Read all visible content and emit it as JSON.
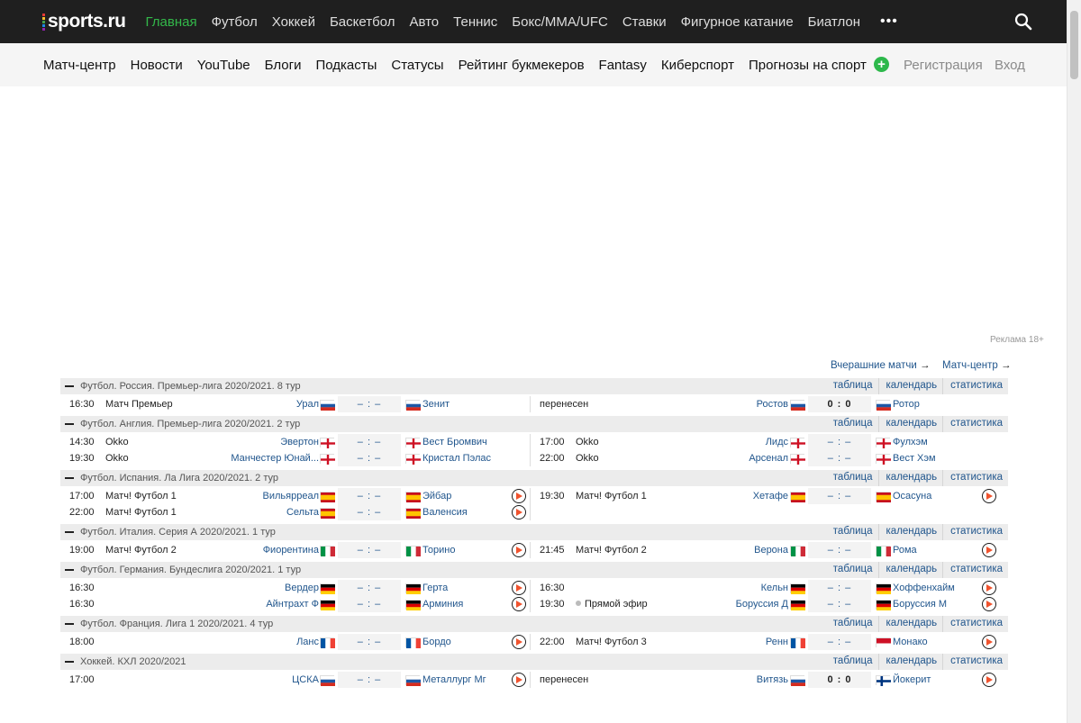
{
  "brand": {
    "logo": "sports.ru"
  },
  "topnav": [
    "Главная",
    "Футбол",
    "Хоккей",
    "Баскетбол",
    "Авто",
    "Теннис",
    "Бокс/MMA/UFC",
    "Ставки",
    "Фигурное катание",
    "Биатлон"
  ],
  "more": "•••",
  "subnav": [
    "Матч-центр",
    "Новости",
    "YouTube",
    "Блоги",
    "Подкасты",
    "Статусы",
    "Рейтинг букмекеров",
    "Fantasy",
    "Киберспорт",
    "Прогнозы на спорт"
  ],
  "auth": {
    "register": "Регистрация",
    "login": "Вход"
  },
  "ad_label": "Реклама 18+",
  "links": {
    "yesterday": "Вчерашние матчи",
    "match_center": "Матч-центр"
  },
  "league_links": {
    "table": "таблица",
    "calendar": "календарь",
    "stats": "статистика"
  },
  "leagues": [
    {
      "title": "Футбол. Россия. Премьер-лига 2020/2021. 8 тур",
      "rows": [
        [
          {
            "time": "16:30",
            "tv": "Матч Премьер",
            "home": "Урал",
            "home_flag": "ru",
            "score": "– : –",
            "away": "Зенит",
            "away_flag": "ru",
            "play": false
          },
          {
            "time": "перенесен",
            "tv": "",
            "home": "Ростов",
            "home_flag": "ru",
            "score": "0 : 0",
            "final": true,
            "away": "Ротор",
            "away_flag": "ru",
            "play": false
          }
        ]
      ]
    },
    {
      "title": "Футбол. Англия. Премьер-лига 2020/2021. 2 тур",
      "rows": [
        [
          {
            "time": "14:30",
            "tv": "Okko",
            "home": "Эвертон",
            "home_flag": "en",
            "score": "– : –",
            "away": "Вест Бромвич",
            "away_flag": "en",
            "play": false
          },
          {
            "time": "17:00",
            "tv": "Okko",
            "home": "Лидс",
            "home_flag": "en",
            "score": "– : –",
            "away": "Фулхэм",
            "away_flag": "en",
            "play": false
          }
        ],
        [
          {
            "time": "19:30",
            "tv": "Okko",
            "home": "Манчестер Юнай...",
            "home_flag": "en",
            "score": "– : –",
            "away": "Кристал Пэлас",
            "away_flag": "en",
            "play": false
          },
          {
            "time": "22:00",
            "tv": "Okko",
            "home": "Арсенал",
            "home_flag": "en",
            "score": "– : –",
            "away": "Вест Хэм",
            "away_flag": "en",
            "play": false
          }
        ]
      ]
    },
    {
      "title": "Футбол. Испания. Ла Лига 2020/2021. 2 тур",
      "rows": [
        [
          {
            "time": "17:00",
            "tv": "Матч! Футбол 1",
            "home": "Вильярреал",
            "home_flag": "es",
            "score": "– : –",
            "away": "Эйбар",
            "away_flag": "es",
            "play": true
          },
          {
            "time": "19:30",
            "tv": "Матч! Футбол 1",
            "home": "Хетафе",
            "home_flag": "es",
            "score": "– : –",
            "away": "Осасуна",
            "away_flag": "es",
            "play": true
          }
        ],
        [
          {
            "time": "22:00",
            "tv": "Матч! Футбол 1",
            "home": "Сельта",
            "home_flag": "es",
            "score": "– : –",
            "away": "Валенсия",
            "away_flag": "es",
            "play": true
          },
          null
        ]
      ]
    },
    {
      "title": "Футбол. Италия. Серия А 2020/2021. 1 тур",
      "rows": [
        [
          {
            "time": "19:00",
            "tv": "Матч! Футбол 2",
            "home": "Фиорентина",
            "home_flag": "it",
            "score": "– : –",
            "away": "Торино",
            "away_flag": "it",
            "play": true
          },
          {
            "time": "21:45",
            "tv": "Матч! Футбол 2",
            "home": "Верона",
            "home_flag": "it",
            "score": "– : –",
            "away": "Рома",
            "away_flag": "it",
            "play": true
          }
        ]
      ]
    },
    {
      "title": "Футбол. Германия. Бундеслига 2020/2021. 1 тур",
      "rows": [
        [
          {
            "time": "16:30",
            "tv": "",
            "home": "Вердер",
            "home_flag": "de",
            "score": "– : –",
            "away": "Герта",
            "away_flag": "de",
            "play": true
          },
          {
            "time": "16:30",
            "tv": "",
            "home": "Кельн",
            "home_flag": "de",
            "score": "– : –",
            "away": "Хоффенхайм",
            "away_flag": "de",
            "play": true
          }
        ],
        [
          {
            "time": "16:30",
            "tv": "",
            "home": "Айнтрахт Ф",
            "home_flag": "de",
            "score": "– : –",
            "away": "Арминия",
            "away_flag": "de",
            "play": true
          },
          {
            "time": "19:30",
            "tv": "Прямой эфир",
            "live": true,
            "home": "Боруссия Д",
            "home_flag": "de",
            "score": "– : –",
            "away": "Боруссия М",
            "away_flag": "de",
            "play": true
          }
        ]
      ]
    },
    {
      "title": "Футбол. Франция. Лига 1 2020/2021. 4 тур",
      "rows": [
        [
          {
            "time": "18:00",
            "tv": "",
            "home": "Ланс",
            "home_flag": "fr",
            "score": "– : –",
            "away": "Бордо",
            "away_flag": "fr",
            "play": true
          },
          {
            "time": "22:00",
            "tv": "Матч! Футбол 3",
            "home": "Ренн",
            "home_flag": "fr",
            "score": "– : –",
            "away": "Монако",
            "away_flag": "mc",
            "play": true
          }
        ]
      ]
    },
    {
      "title": "Хоккей. КХЛ 2020/2021",
      "rows": [
        [
          {
            "time": "17:00",
            "tv": "",
            "home": "ЦСКА",
            "home_flag": "ru",
            "score": "– : –",
            "away": "Металлург Мг",
            "away_flag": "ru",
            "play": true
          },
          {
            "time": "перенесен",
            "tv": "",
            "home": "Витязь",
            "home_flag": "ru",
            "score": "0 : 0",
            "final": true,
            "away": "Йокерит",
            "away_flag": "fi",
            "play": true
          }
        ]
      ]
    }
  ],
  "colors": {
    "accent": "#33b84a",
    "link": "#21568d",
    "topbar": "#1f1f1f"
  }
}
